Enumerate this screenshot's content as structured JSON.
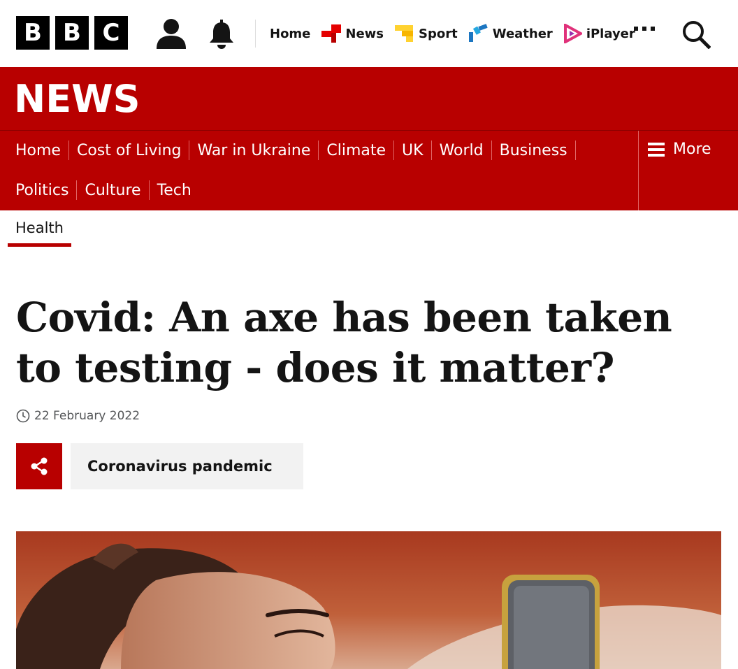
{
  "bbc_logo": [
    "B",
    "B",
    "C"
  ],
  "top_nav": [
    {
      "label": "Home",
      "icon": "none"
    },
    {
      "label": "News",
      "icon": "news-icon",
      "color": "#e50000"
    },
    {
      "label": "Sport",
      "icon": "sport-icon",
      "color": "#ffd230"
    },
    {
      "label": "Weather",
      "icon": "weather-icon",
      "color": "#1c76c1"
    },
    {
      "label": "iPlayer",
      "icon": "iplayer-icon",
      "color": "#e0317a"
    }
  ],
  "news_banner": {
    "title": "NEWS",
    "color": "#b80000"
  },
  "section_nav": {
    "row1": [
      "Home",
      "Cost of Living",
      "War in Ukraine",
      "Climate",
      "UK",
      "World",
      "Business"
    ],
    "row2": [
      "Politics",
      "Culture",
      "Tech"
    ],
    "more_label": "More"
  },
  "subnav": {
    "active_tab": "Health"
  },
  "article": {
    "headline_line1": "Covid: An axe has been taken",
    "headline_line2": "to testing - does it matter?",
    "date": "22 February 2022",
    "topic": "Coronavirus pandemic"
  }
}
